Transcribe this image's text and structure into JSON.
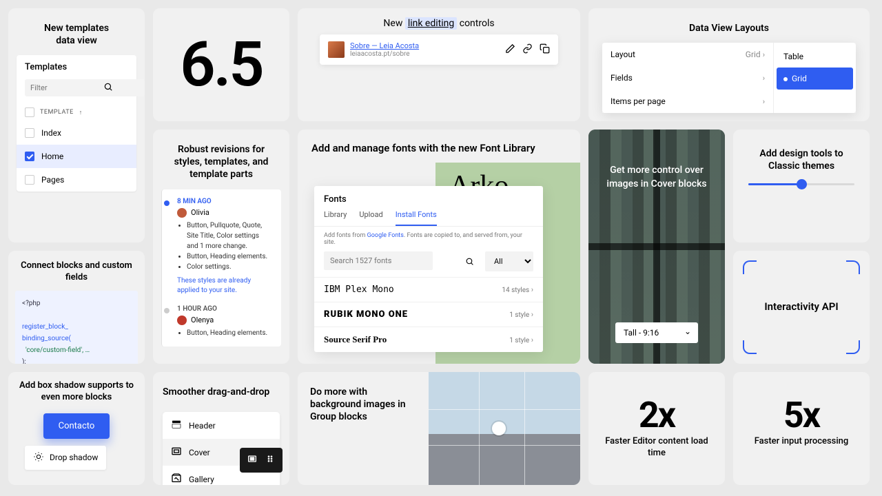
{
  "templates_card": {
    "title": "New templates\ndata view",
    "panel_title": "Templates",
    "filter_placeholder": "Filter",
    "column_header": "TEMPLATE",
    "sort_arrow": "↑",
    "items": [
      "Index",
      "Home",
      "Pages"
    ]
  },
  "version_card": {
    "number": "6.5"
  },
  "link_card": {
    "heading_pre": "New",
    "heading_hl": "link editing",
    "heading_post": "controls",
    "link_title": "Sobre — Leia Acosta",
    "link_sub": "leiaacosta.pt/sobre"
  },
  "layouts_card": {
    "title": "Data View Layouts",
    "rows": [
      {
        "label": "Layout",
        "value": "Grid"
      },
      {
        "label": "Fields",
        "value": ""
      },
      {
        "label": "Items per page",
        "value": ""
      }
    ],
    "options": [
      "Table",
      "Grid"
    ]
  },
  "revisions": {
    "title": "Robust revisions for styles, templates, and template parts",
    "entries": [
      {
        "time": "8 MIN AGO",
        "user": "Olivia",
        "avatar": "#c05a3a",
        "changes": [
          "Button, Pullquote, Quote, Site Title, Color settings and 1 more change.",
          "Button, Heading elements.",
          "Color settings."
        ],
        "note": "These styles are already applied to your site."
      },
      {
        "time": "1 HOUR AGO",
        "user": "Olenya",
        "avatar": "#c0392b",
        "changes": [
          "Button, Heading elements."
        ]
      }
    ]
  },
  "fonts": {
    "title": "Add and manage fonts with the new Font Library",
    "sample": "Arko",
    "panel_title": "Fonts",
    "tabs": [
      "Library",
      "Upload",
      "Install Fonts"
    ],
    "note_pre": "Add fonts from ",
    "note_link": "Google Fonts",
    "note_post": ". Fonts are copied to, and served from, your site.",
    "search_placeholder": "Search 1527 fonts",
    "filter_all": "All",
    "list": [
      {
        "name": "IBM Plex Mono",
        "meta": "14 styles",
        "cls": "ibm"
      },
      {
        "name": "RUBIK MONO ONE",
        "meta": "1 style",
        "cls": "rubik"
      },
      {
        "name": "Source Serif Pro",
        "meta": "1 style",
        "cls": "serifp"
      }
    ]
  },
  "cover": {
    "title": "Get more control over images in Cover blocks",
    "select": "Tall - 9:16"
  },
  "classic": {
    "title": "Add design tools to Classic themes"
  },
  "interactivity": {
    "title": "Interactivity API"
  },
  "bindings": {
    "title": "Connect blocks and custom fields",
    "code_l1": "<?php",
    "code_l2": "register_block_",
    "code_l3": "binding_source(",
    "code_l4": "  'core/custom-field', …",
    "code_l5": ");"
  },
  "shadow": {
    "title": "Add box shadow supports to even more blocks",
    "button": "Contacto",
    "chip": "Drop shadow"
  },
  "dragdrop": {
    "title": "Smoother drag-and-drop",
    "items": [
      "Header",
      "Cover",
      "Gallery"
    ]
  },
  "groupbg": {
    "title": "Do more with background images in Group blocks"
  },
  "stat1": {
    "num": "2x",
    "label": "Faster Editor content load time"
  },
  "stat2": {
    "num": "5x",
    "label": "Faster input processing"
  }
}
